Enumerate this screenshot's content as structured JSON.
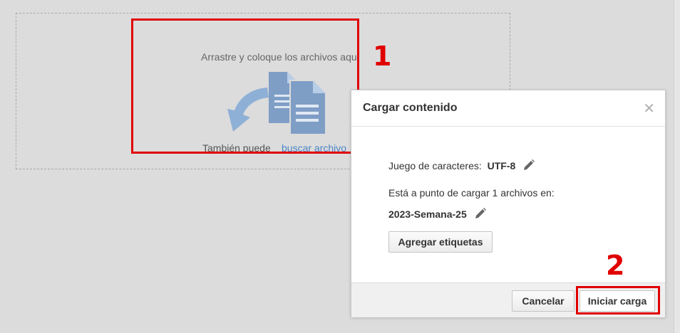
{
  "dropzone": {
    "drag_text": "Arrastre y coloque los archivos aquí",
    "also_text": "También puede",
    "browse_link": "buscar archivo",
    "illustration_icon": "documents-drop-icon"
  },
  "dialog": {
    "title": "Cargar contenido",
    "close_icon": "close-icon",
    "charset_label": "Juego de caracteres:",
    "charset_value": "UTF-8",
    "target_label": "Está a punto de cargar 1 archivos en:",
    "target_value": "2023-Semana-25",
    "add_tags_label": "Agregar etiquetas",
    "cancel_label": "Cancelar",
    "start_label": "Iniciar carga"
  },
  "annotations": [
    {
      "label": "1"
    },
    {
      "label": "2"
    }
  ],
  "colors": {
    "annotation": "#e00000",
    "link": "#4a86c5",
    "icon": "#7f9ec6"
  }
}
